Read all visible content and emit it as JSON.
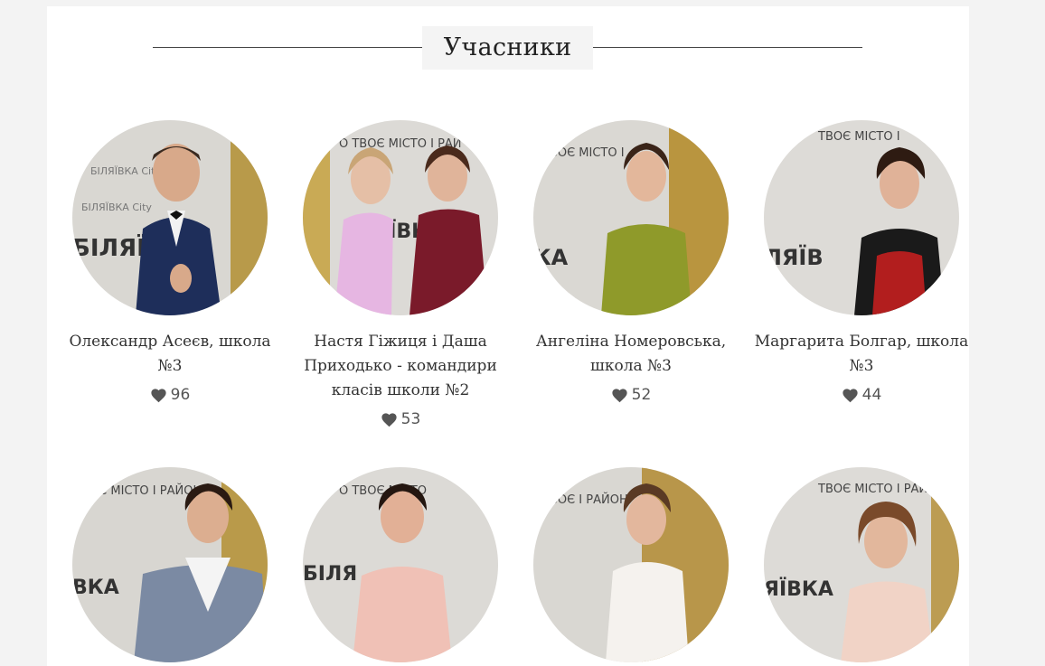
{
  "section": {
    "title": "Учасники"
  },
  "participants": [
    {
      "name": "Олександр Асеєв, школа №3",
      "likes": "96"
    },
    {
      "name": "Настя Гіжиця і Даша Приходько - командири класів школи №2",
      "likes": "53"
    },
    {
      "name": "Ангеліна Номеровська, школа №3",
      "likes": "52"
    },
    {
      "name": "Маргарита Болгар, школа №3",
      "likes": "44"
    },
    {
      "name": "",
      "likes": ""
    },
    {
      "name": "",
      "likes": ""
    },
    {
      "name": "",
      "likes": ""
    },
    {
      "name": "",
      "likes": ""
    }
  ],
  "colors": {
    "panel_bg": "#ffffff",
    "page_bg": "#f3f3f3",
    "heart": "#555555",
    "title_bg": "#f4f4f4"
  },
  "icons": {
    "like": "heart-icon"
  }
}
